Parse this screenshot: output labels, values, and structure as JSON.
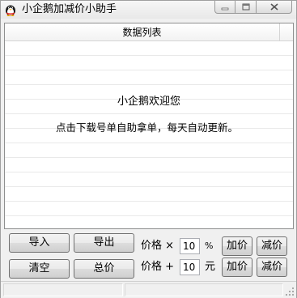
{
  "window": {
    "title": "小企鹅加减价小助手"
  },
  "list": {
    "header": "数据列表",
    "welcome": "小企鹅欢迎您",
    "hint": "点击下载号单自助拿单，每天自动更新。"
  },
  "buttons": {
    "import": "导入",
    "export": "导出",
    "clear": "清空",
    "total": "总价",
    "add1": "加价",
    "sub1": "减价",
    "add2": "加价",
    "sub2": "减价"
  },
  "percent_row": {
    "label": "价格 ×",
    "value": "10",
    "unit": "%"
  },
  "yuan_row": {
    "label": "价格 +",
    "value": "10",
    "unit": "元"
  }
}
